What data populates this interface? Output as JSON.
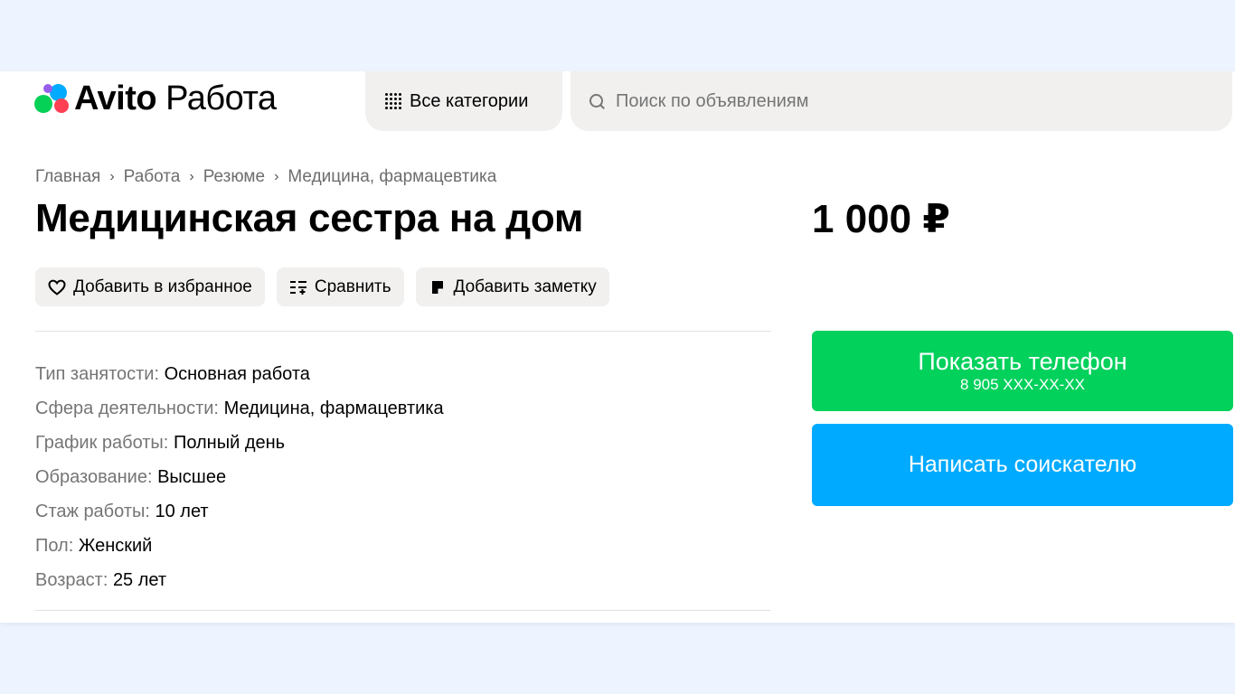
{
  "header": {
    "logo_brand": "Avito",
    "logo_product": "Работа",
    "categories_label": "Все категории",
    "search_placeholder": "Поиск по объявлениям"
  },
  "breadcrumb": [
    "Главная",
    "Работа",
    "Резюме",
    "Медицина, фармацевтика"
  ],
  "listing": {
    "title": "Медицинская сестра на дом",
    "price": "1 000 ₽"
  },
  "actions": {
    "favorite": "Добавить в избранное",
    "compare": "Сравнить",
    "note": "Добавить заметку"
  },
  "params": [
    {
      "key": "Тип занятости:",
      "value": "Основная работа"
    },
    {
      "key": "Сфера деятельности:",
      "value": "Медицина, фармацевтика"
    },
    {
      "key": "График работы:",
      "value": "Полный день"
    },
    {
      "key": "Образование:",
      "value": "Высшее"
    },
    {
      "key": "Стаж работы:",
      "value": "10 лет"
    },
    {
      "key": "Пол:",
      "value": "Женский"
    },
    {
      "key": "Возраст:",
      "value": "25 лет"
    }
  ],
  "contact": {
    "show_phone": "Показать телефон",
    "phone_masked": "8 905 XXX-XX-XX",
    "write": "Написать соискателю"
  },
  "colors": {
    "page_bg": "#eef4ff",
    "green": "#02d15c",
    "blue": "#00aaff",
    "chip_bg": "#f1f0ef"
  },
  "icons": [
    "heart-icon",
    "compare-icon",
    "note-icon",
    "grid-icon",
    "search-icon"
  ]
}
